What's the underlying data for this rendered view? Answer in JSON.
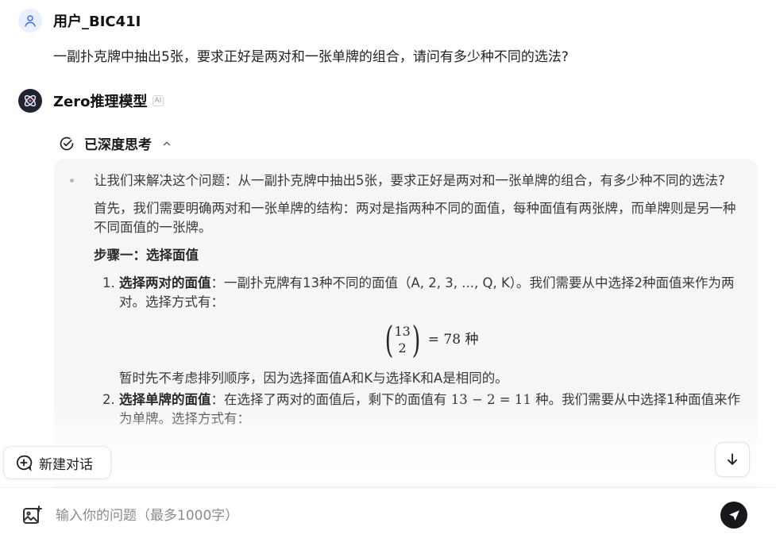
{
  "user": {
    "name": "用户_BIC41I",
    "question": "一副扑克牌中抽出5张，要求正好是两对和一张单牌的组合，请问有多少种不同的选法?"
  },
  "assistant": {
    "name": "Zero推理模型",
    "badge": "AI"
  },
  "thinking": {
    "label": "已深度思考",
    "para1": "让我们来解决这个问题：从一副扑克牌中抽出5张，要求正好是两对和一张单牌的组合，有多少种不同的选法?",
    "para2": "首先，我们需要明确两对和一张单牌的结构：两对是指两种不同的面值，每种面值有两张牌，而单牌则是另一种不同面值的一张牌。",
    "step1_heading": "步骤一：选择面值",
    "item1": {
      "bold": "选择两对的面值",
      "text": "：一副扑克牌有13种不同的面值（A, 2, 3, ..., Q, K）。我们需要从中选择2种面值来作为两对。选择方式有：",
      "math_top": "13",
      "math_bottom": "2",
      "math_rest": "= 78 种",
      "after": "暂时先不考虑排列顺序，因为选择面值A和K与选择K和A是相同的。"
    },
    "item2": {
      "bold": "选择单牌的面值",
      "text_a": "：在选择了两对的面值后，剩下的面值有 ",
      "math": "13 − 2 = 11",
      "text_b": " 种。我们需要从中选择1种面值来作为单牌。选择方式有："
    }
  },
  "actions": {
    "new_chat": "新建对话"
  },
  "input": {
    "placeholder": "输入你的问题（最多1000字）"
  }
}
